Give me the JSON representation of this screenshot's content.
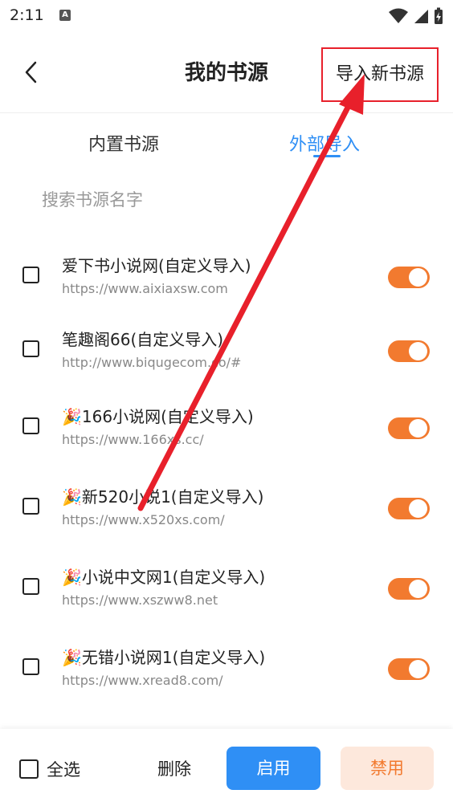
{
  "status_bar": {
    "time": "2:11",
    "a_badge": "A"
  },
  "header": {
    "title": "我的书源",
    "import_button": "导入新书源"
  },
  "tabs": [
    {
      "label": "内置书源",
      "active": false
    },
    {
      "label": "外部导入",
      "active": true
    }
  ],
  "search": {
    "placeholder": "搜索书源名字",
    "value": ""
  },
  "sources": [
    {
      "emoji": "",
      "name": "爱下书小说网(自定义导入)",
      "url": "https://www.aixiaxsw.com",
      "enabled": true,
      "checked": false
    },
    {
      "emoji": "",
      "name": "笔趣阁66(自定义导入)",
      "url": "http://www.biqugecom.co/#",
      "enabled": true,
      "checked": false
    },
    {
      "emoji": "🎉",
      "name": "166小说网(自定义导入)",
      "url": "https://www.166xs.cc/",
      "enabled": true,
      "checked": false
    },
    {
      "emoji": "🎉",
      "name": "新520小说1(自定义导入)",
      "url": "https://www.x520xs.com/",
      "enabled": true,
      "checked": false
    },
    {
      "emoji": "🎉",
      "name": "小说中文网1(自定义导入)",
      "url": "https://www.xszww8.net",
      "enabled": true,
      "checked": false
    },
    {
      "emoji": "🎉",
      "name": "无错小说网1(自定义导入)",
      "url": "https://www.xread8.com/",
      "enabled": true,
      "checked": false
    }
  ],
  "bottom_bar": {
    "select_all": "全选",
    "delete": "删除",
    "enable": "启用",
    "disable": "禁用"
  },
  "colors": {
    "accent_blue": "#2f8ff5",
    "toggle_orange": "#f27a2f",
    "annotation_red": "#e8202b"
  }
}
